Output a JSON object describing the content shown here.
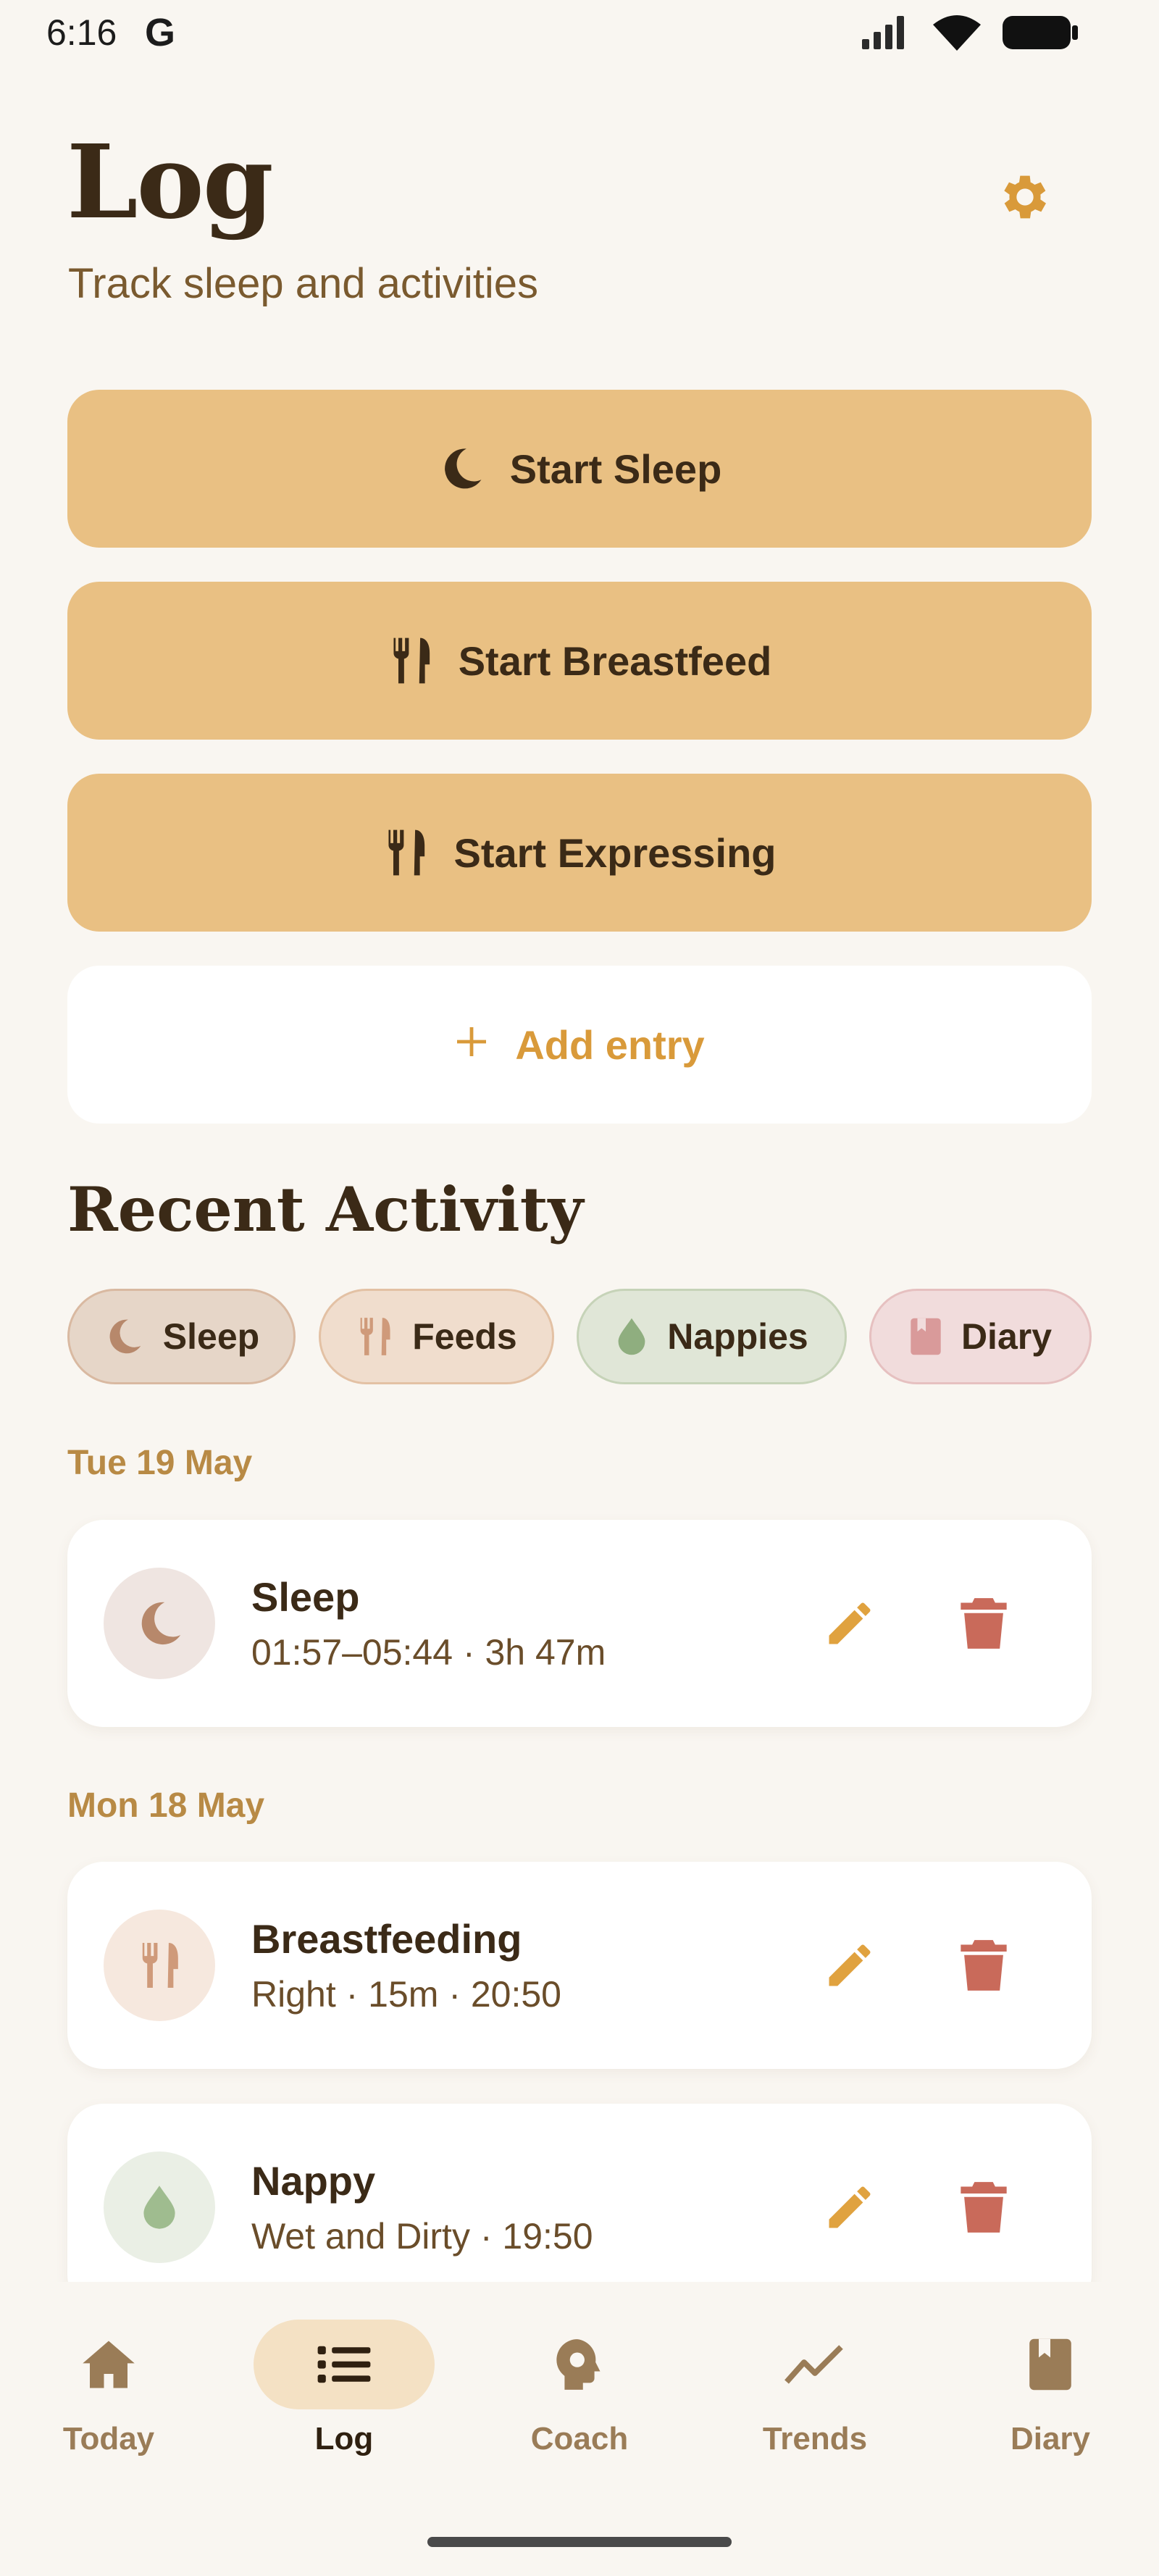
{
  "status_bar": {
    "time": "6:16",
    "g_label": "G",
    "icons": [
      "signal-icon",
      "wifi-icon",
      "battery-icon"
    ]
  },
  "header": {
    "title": "Log",
    "subtitle": "Track sleep and activities",
    "settings_icon": "gear-icon"
  },
  "actions": {
    "start_sleep": "Start Sleep",
    "start_breastfeed": "Start Breastfeed",
    "start_expressing": "Start Expressing",
    "add_entry": "Add entry"
  },
  "recent": {
    "title": "Recent Activity",
    "filters": [
      {
        "label": "Sleep",
        "icon": "moon-icon",
        "bg": "#e6d6c8",
        "border": "#d9b9a1"
      },
      {
        "label": "Feeds",
        "icon": "utensils-icon",
        "bg": "#f0ddcd",
        "border": "#e3c1a4"
      },
      {
        "label": "Nappies",
        "icon": "drop-icon",
        "bg": "#e0e6d7",
        "border": "#c6d3b8"
      },
      {
        "label": "Diary",
        "icon": "book-icon",
        "bg": "#f1dcdc",
        "border": "#e6c0c0"
      }
    ],
    "groups": [
      {
        "date": "Tue 19 May",
        "entries": [
          {
            "title": "Sleep",
            "detail": "01:57–05:44 · 3h 47m",
            "icon": "moon-icon"
          }
        ]
      },
      {
        "date": "Mon 18 May",
        "entries": [
          {
            "title": "Breastfeeding",
            "detail": "Right · 15m · 20:50",
            "icon": "utensils-icon"
          },
          {
            "title": "Nappy",
            "detail": "Wet and Dirty · 19:50",
            "icon": "drop-icon"
          }
        ]
      }
    ]
  },
  "nav": {
    "items": [
      {
        "label": "Today",
        "icon": "home-icon"
      },
      {
        "label": "Log",
        "icon": "list-icon",
        "active": true
      },
      {
        "label": "Coach",
        "icon": "coach-head-icon"
      },
      {
        "label": "Trends",
        "icon": "trend-line-icon"
      },
      {
        "label": "Diary",
        "icon": "book-icon"
      }
    ]
  },
  "colors": {
    "background": "#f9f6f1",
    "primary_button": "#e9c083",
    "accent": "#d99a3a",
    "text_dark": "#3b2a17",
    "delete": "#c96a5a"
  }
}
